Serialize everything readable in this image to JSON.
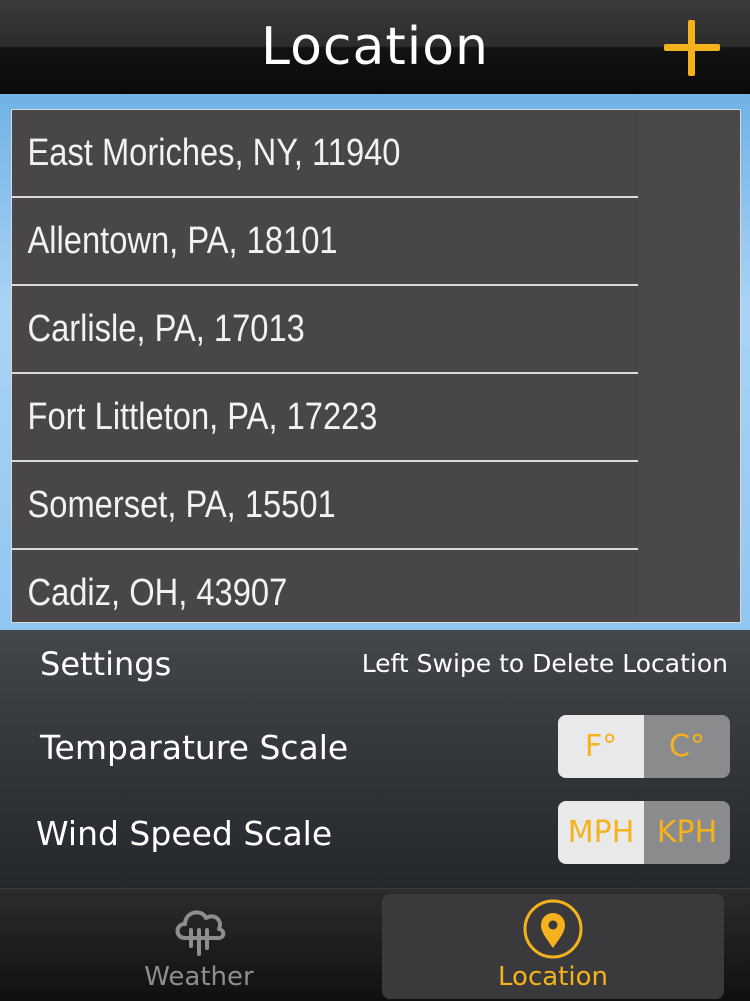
{
  "header": {
    "title": "Location",
    "add_icon": "plus-icon",
    "accent": "#f5b21d"
  },
  "locations": [
    {
      "label": "East Moriches, NY, 11940"
    },
    {
      "label": "Allentown, PA, 18101"
    },
    {
      "label": "Carlisle, PA, 17013"
    },
    {
      "label": "Fort Littleton, PA, 17223"
    },
    {
      "label": "Somerset, PA, 15501"
    },
    {
      "label": "Cadiz, OH, 43907"
    }
  ],
  "settings": {
    "title": "Settings",
    "hint": "Left Swipe to Delete Location",
    "temperature": {
      "label": "Temparature Scale",
      "options": [
        "F°",
        "C°"
      ],
      "selected": "F°"
    },
    "wind": {
      "label": "Wind Speed Scale",
      "options": [
        "MPH",
        "KPH"
      ],
      "selected": "MPH"
    }
  },
  "tabs": [
    {
      "label": "Weather",
      "icon": "cloud-rain-icon",
      "active": false
    },
    {
      "label": "Location",
      "icon": "map-pin-icon",
      "active": true
    }
  ]
}
